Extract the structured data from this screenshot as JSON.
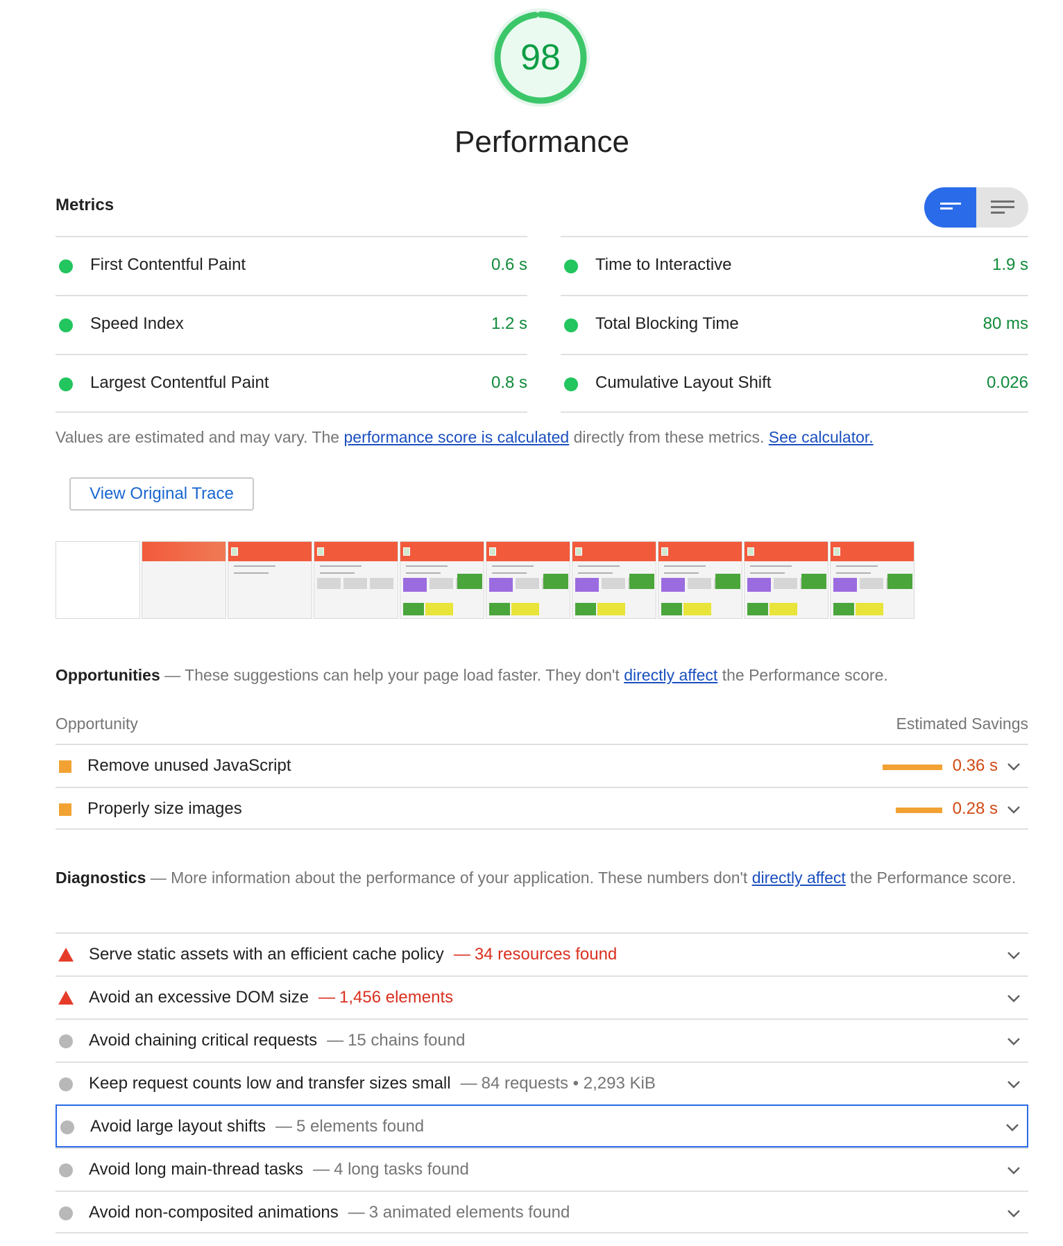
{
  "gauge": {
    "score": "98",
    "score_fraction": 0.98,
    "title": "Performance",
    "color": "#0c9d44"
  },
  "metrics": {
    "title": "Metrics",
    "toggle": {
      "active": "bars-view-icon",
      "inactive": "list-view-icon"
    },
    "left": [
      {
        "name": "First Contentful Paint",
        "value": "0.6 s"
      },
      {
        "name": "Speed Index",
        "value": "1.2 s"
      },
      {
        "name": "Largest Contentful Paint",
        "value": "0.8 s"
      }
    ],
    "right": [
      {
        "name": "Time to Interactive",
        "value": "1.9 s"
      },
      {
        "name": "Total Blocking Time",
        "value": "80 ms"
      },
      {
        "name": "Cumulative Layout Shift",
        "value": "0.026"
      }
    ],
    "note": {
      "prefix": "Values are estimated and may vary. The ",
      "link1": "performance score is calculated",
      "middle": " directly from these metrics.",
      "link2": "See calculator."
    }
  },
  "trace_button": "View Original Trace",
  "filmstrip": {
    "frame_count": 10
  },
  "opportunities": {
    "title": "Opportunities",
    "dash": " — ",
    "desc_prefix": "These suggestions can help your page load faster. They don't ",
    "desc_link": "directly affect",
    "desc_suffix": " the Performance score.",
    "col_left": "Opportunity",
    "col_right": "Estimated Savings",
    "items": [
      {
        "title": "Remove unused JavaScript",
        "value": "0.36 s",
        "savings_s": 0.36
      },
      {
        "title": "Properly size images",
        "value": "0.28 s",
        "savings_s": 0.28
      }
    ]
  },
  "diagnostics": {
    "title": "Diagnostics",
    "dash": " — ",
    "desc_prefix": "More information about the performance of your application. These numbers don't ",
    "desc_link": "directly affect",
    "desc_suffix": " the Performance score.",
    "items": [
      {
        "title": "Serve static assets with an efficient cache policy",
        "detail": "34 resources found",
        "severity": "fail"
      },
      {
        "title": "Avoid an excessive DOM size",
        "detail": "1,456 elements",
        "severity": "fail"
      },
      {
        "title": "Avoid chaining critical requests",
        "detail": "15 chains found",
        "severity": "info"
      },
      {
        "title": "Keep request counts low and transfer sizes small",
        "detail": "84 requests • 2,293 KiB",
        "severity": "info"
      },
      {
        "title": "Avoid large layout shifts",
        "detail": "5 elements found",
        "severity": "info",
        "focused": true
      },
      {
        "title": "Avoid long main-thread tasks",
        "detail": "4 long tasks found",
        "severity": "info"
      },
      {
        "title": "Avoid non-composited animations",
        "detail": "3 animated elements found",
        "severity": "info"
      }
    ]
  },
  "colors": {
    "pass": "#22c55e",
    "average": "#f2a233",
    "fail": "#e53c2a",
    "link": "#1a4fbf",
    "accent": "#2a6be9"
  }
}
